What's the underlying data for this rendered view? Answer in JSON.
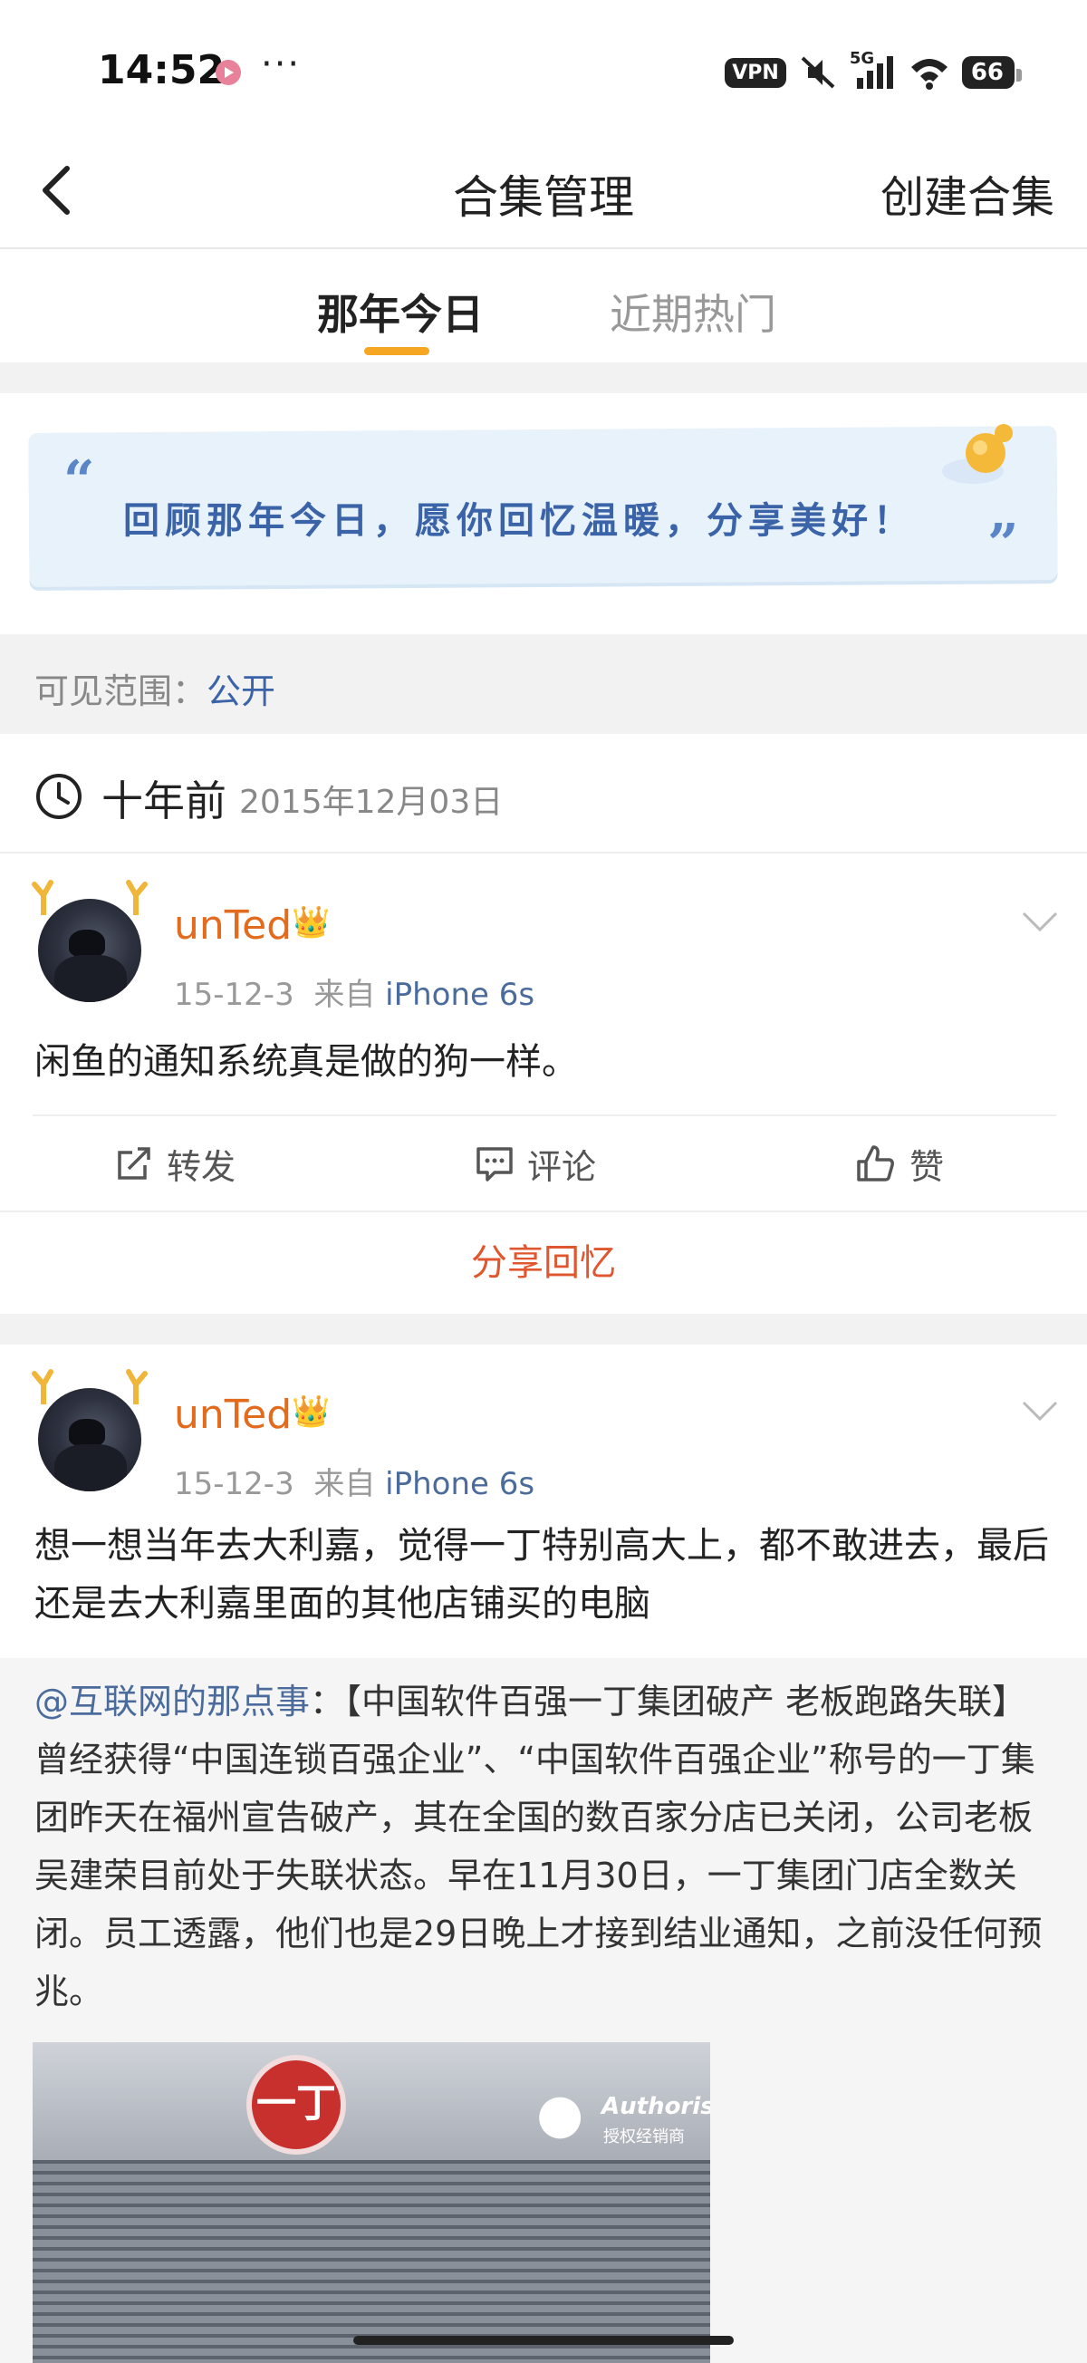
{
  "status_bar": {
    "time": "14:52",
    "more": "···",
    "vpn": "VPN",
    "network": "5G",
    "battery": "66"
  },
  "nav": {
    "title": "合集管理",
    "create_label": "创建合集"
  },
  "tabs": [
    {
      "label": "那年今日",
      "active": true
    },
    {
      "label": "近期热门",
      "active": false
    }
  ],
  "banner": {
    "text": "回顾那年今日，愿你回忆温暖，分享美好！",
    "quote_open": "“",
    "quote_close": "”"
  },
  "visibility": {
    "label": "可见范围：",
    "value": "公开"
  },
  "date_header": {
    "ago": "十年前",
    "date": "2015年12月03日"
  },
  "posts": [
    {
      "username": "unTed",
      "crown": "👑",
      "date": "15-12-3",
      "from": "来自",
      "device": "iPhone 6s",
      "text": "闲鱼的通知系统真是做的狗一样。",
      "actions": {
        "repost": "转发",
        "comment": "评论",
        "like": "赞"
      },
      "share_label": "分享回忆"
    },
    {
      "username": "unTed",
      "crown": "👑",
      "date": "15-12-3",
      "from": "来自",
      "device": "iPhone 6s",
      "text": "想一想当年去大利嘉，觉得一丁特别高大上，都不敢进去，最后还是去大利嘉里面的其他店铺买的电脑",
      "repost": {
        "mention": "@互联网的那点事",
        "text": "：【中国软件百强一丁集团破产 老板跑路失联】曾经获得“中国连锁百强企业”、“中国软件百强企业”称号的一丁集团昨天在福州宣告破产，其在全国的数百家分店已关闭，公司老板吴建荣目前处于失联状态。早在11月30日，一丁集团门店全数关闭。员工透露，他们也是29日晚上才接到结业通知，之前没任何预兆。",
        "image": {
          "logo_text": "一丁",
          "auth_text": "Authorise",
          "auth_cn": "授权经销商"
        }
      }
    }
  ]
}
